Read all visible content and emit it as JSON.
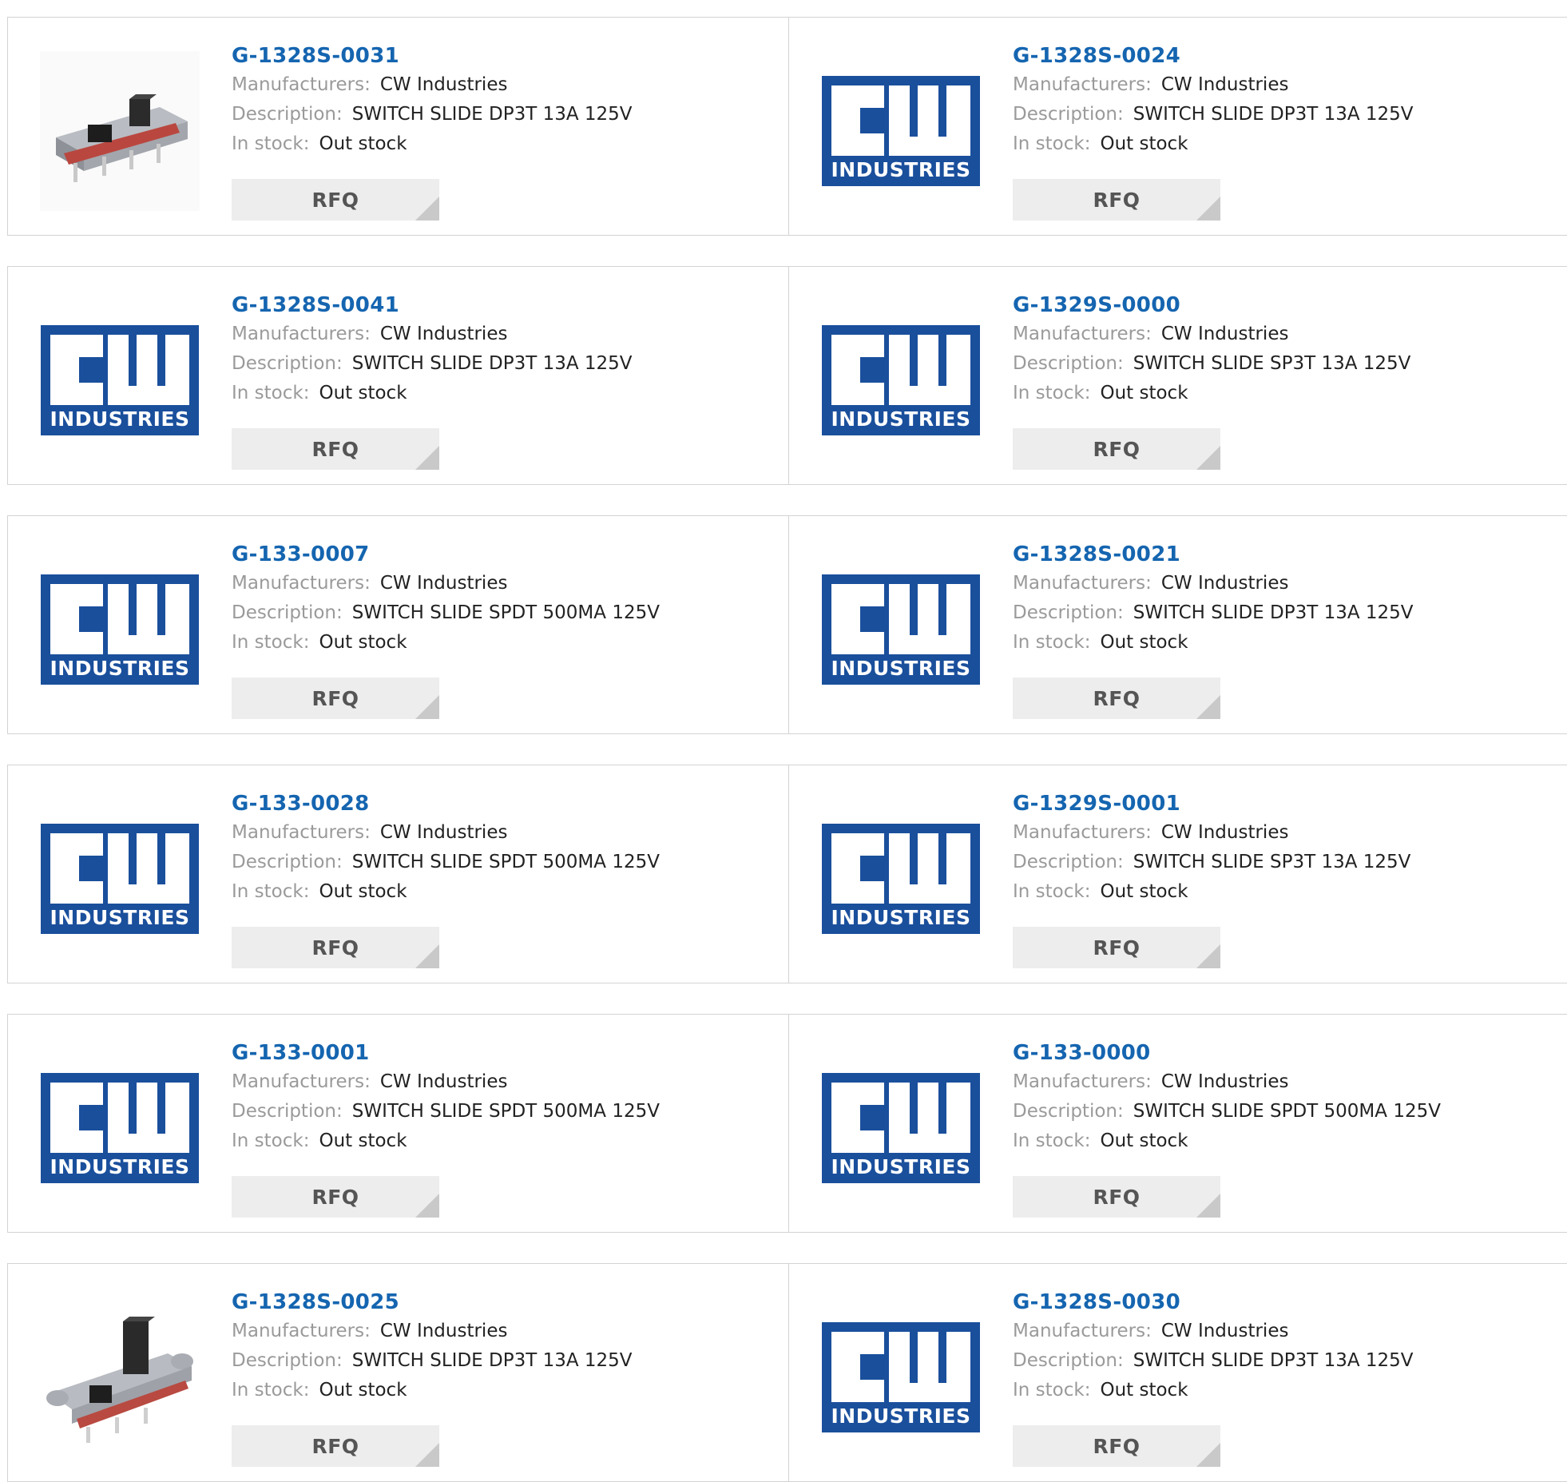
{
  "labels": {
    "manufacturers": "Manufacturers:",
    "description": "Description:",
    "in_stock": "In stock:",
    "rfq": "RFQ"
  },
  "logo": {
    "top": "CW",
    "bottom": "INDUSTRIES",
    "bg_color": "#1a4f9c"
  },
  "colors": {
    "part_number": "#1565b0",
    "label": "#9a9a9a",
    "value": "#222222",
    "rfq_bg": "#ededed",
    "border": "#d3d3d3"
  },
  "products": [
    {
      "part": "G-1328S-0031",
      "manufacturer": "CW Industries",
      "description": "SWITCH SLIDE DP3T 13A 125V",
      "stock": "Out stock",
      "image": "slide-switch-photo-flat"
    },
    {
      "part": "G-1328S-0024",
      "manufacturer": "CW Industries",
      "description": "SWITCH SLIDE DP3T 13A 125V",
      "stock": "Out stock",
      "image": "cw-industries-logo"
    },
    {
      "part": "G-1328S-0041",
      "manufacturer": "CW Industries",
      "description": "SWITCH SLIDE DP3T 13A 125V",
      "stock": "Out stock",
      "image": "cw-industries-logo"
    },
    {
      "part": "G-1329S-0000",
      "manufacturer": "CW Industries",
      "description": "SWITCH SLIDE SP3T 13A 125V",
      "stock": "Out stock",
      "image": "cw-industries-logo"
    },
    {
      "part": "G-133-0007",
      "manufacturer": "CW Industries",
      "description": "SWITCH SLIDE SPDT 500MA 125V",
      "stock": "Out stock",
      "image": "cw-industries-logo"
    },
    {
      "part": "G-1328S-0021",
      "manufacturer": "CW Industries",
      "description": "SWITCH SLIDE DP3T 13A 125V",
      "stock": "Out stock",
      "image": "cw-industries-logo"
    },
    {
      "part": "G-133-0028",
      "manufacturer": "CW Industries",
      "description": "SWITCH SLIDE SPDT 500MA 125V",
      "stock": "Out stock",
      "image": "cw-industries-logo"
    },
    {
      "part": "G-1329S-0001",
      "manufacturer": "CW Industries",
      "description": "SWITCH SLIDE SP3T 13A 125V",
      "stock": "Out stock",
      "image": "cw-industries-logo"
    },
    {
      "part": "G-133-0001",
      "manufacturer": "CW Industries",
      "description": "SWITCH SLIDE SPDT 500MA 125V",
      "stock": "Out stock",
      "image": "cw-industries-logo"
    },
    {
      "part": "G-133-0000",
      "manufacturer": "CW Industries",
      "description": "SWITCH SLIDE SPDT 500MA 125V",
      "stock": "Out stock",
      "image": "cw-industries-logo"
    },
    {
      "part": "G-1328S-0025",
      "manufacturer": "CW Industries",
      "description": "SWITCH SLIDE DP3T 13A 125V",
      "stock": "Out stock",
      "image": "slide-switch-photo-tall"
    },
    {
      "part": "G-1328S-0030",
      "manufacturer": "CW Industries",
      "description": "SWITCH SLIDE DP3T 13A 125V",
      "stock": "Out stock",
      "image": "cw-industries-logo"
    }
  ]
}
